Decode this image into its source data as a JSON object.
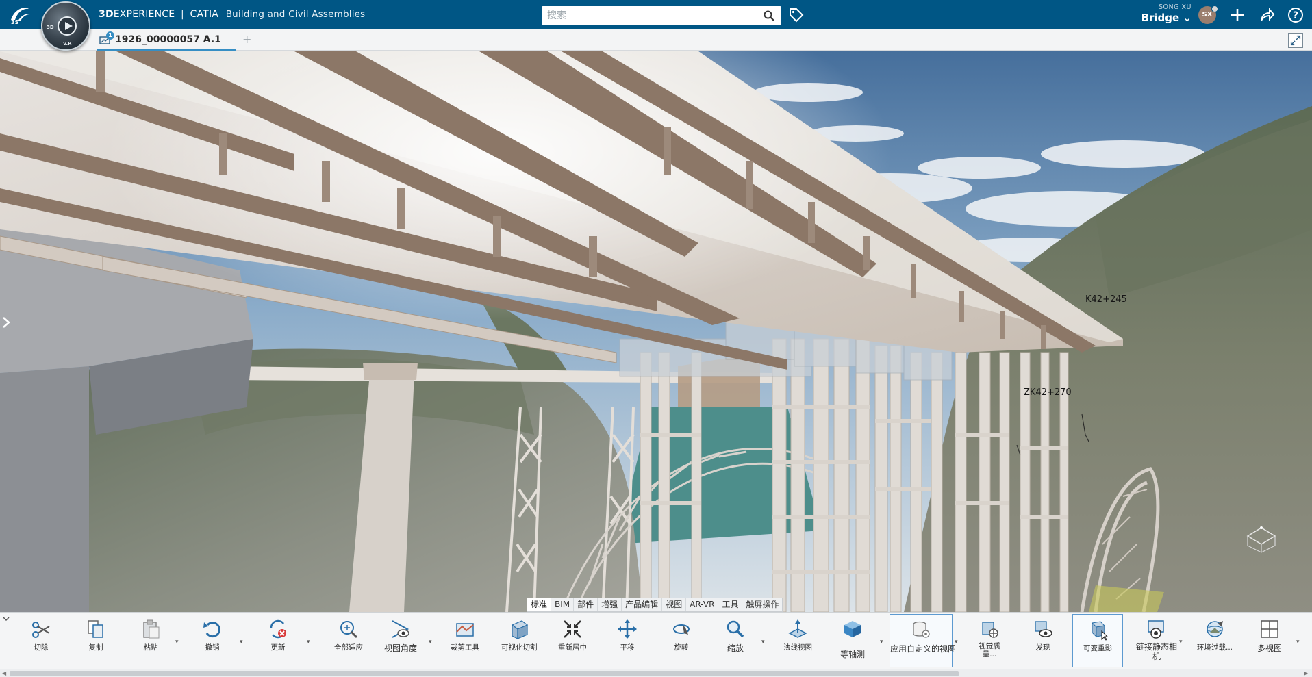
{
  "app": {
    "brand_bold": "3D",
    "brand_rest": "EXPERIENCE",
    "brand_sep": "|",
    "brand_product": "CATIA",
    "app_name": "Building and Civil Assemblies",
    "compass_3d": "3D",
    "compass_vr": "V.R"
  },
  "search": {
    "placeholder": "搜索"
  },
  "user": {
    "name": "SONG XU",
    "space": "Bridge ⌄",
    "initials": "SX"
  },
  "tab": {
    "label": "1926_00000057 A.1",
    "badge": "1",
    "add": "+"
  },
  "viewport": {
    "labels": [
      "K42+245",
      "ZK42+270"
    ]
  },
  "ribbon_tabs": [
    "标准",
    "BIM",
    "部件",
    "增强",
    "产品编辑",
    "视图",
    "AR-VR",
    "工具",
    "触屏操作"
  ],
  "ribbon_active": "视图",
  "tools": [
    {
      "label": "切除",
      "icon": "scissors-icon"
    },
    {
      "label": "复制",
      "icon": "copy-icon"
    },
    {
      "label": "粘贴",
      "icon": "paste-icon"
    },
    {
      "label": "撤销",
      "icon": "undo-icon"
    },
    {
      "label": "更新",
      "icon": "update-icon"
    },
    {
      "label": "全部适应",
      "icon": "fit-all-icon"
    },
    {
      "label": "视图角度",
      "icon": "view-angle-icon"
    },
    {
      "label": "裁剪工具",
      "icon": "clipping-tool-icon"
    },
    {
      "label": "可视化切割",
      "icon": "visual-cut-icon"
    },
    {
      "label": "重新居中",
      "icon": "recenter-icon"
    },
    {
      "label": "平移",
      "icon": "pan-icon"
    },
    {
      "label": "旋转",
      "icon": "rotate-icon"
    },
    {
      "label": "缩放",
      "icon": "zoom-icon"
    },
    {
      "label": "法线视图",
      "icon": "normal-view-icon"
    },
    {
      "label": "等轴测",
      "icon": "isometric-icon"
    },
    {
      "label": "应用自定义的视图",
      "icon": "custom-view-icon"
    },
    {
      "label": "视觉质量...",
      "icon": "visual-quality-icon"
    },
    {
      "label": "发现",
      "icon": "discover-icon"
    },
    {
      "label": "可变重影",
      "icon": "ghost-icon"
    },
    {
      "label": "链接静态相机",
      "icon": "static-camera-icon"
    },
    {
      "label": "环境过载...",
      "icon": "environment-icon"
    },
    {
      "label": "多视图",
      "icon": "multi-view-icon"
    }
  ],
  "colors": {
    "topbar": "#005685",
    "accent": "#368ec4",
    "bridge_concrete": "#ddd6cf",
    "bridge_shadow": "#8e7b6c"
  }
}
